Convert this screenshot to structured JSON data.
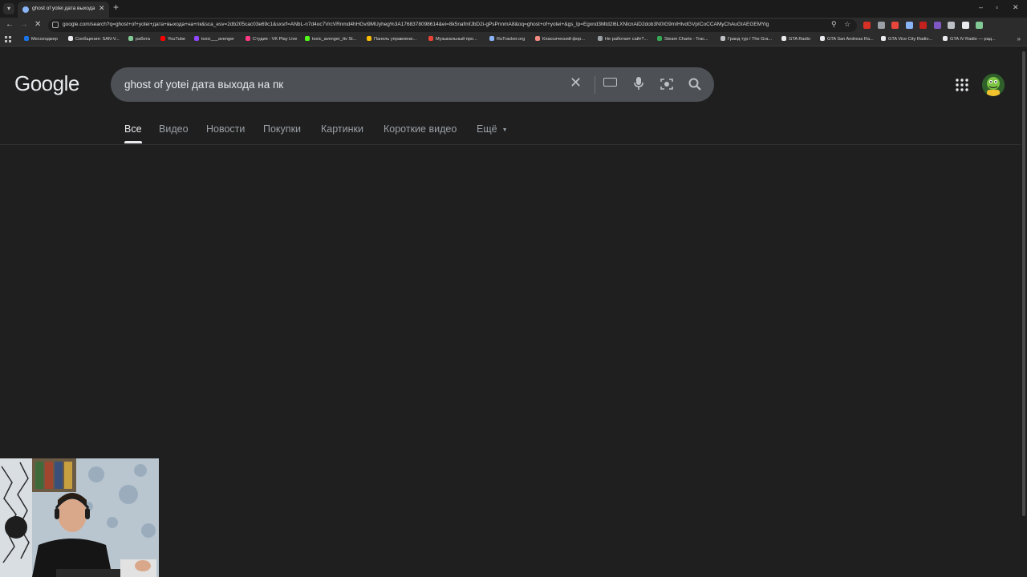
{
  "browser": {
    "tab_title": "ghost of yotei дата выхода на",
    "new_tab_glyph": "+",
    "close_glyph": "✕",
    "url": "google.com/search?q=ghost+of+yotei+дата+выхода+на+пк&sca_esv=2db205cac03e69c1&sxsrf=ANbL-n7d4oc7VrcVRnmd4hHGvi9MUyheg%3A1768378098614&ei=8k5nafmfJbD2i-gPsPnnmA8&oq=ghost+of+yotei+&gs_lp=Egxnd3Mtd2l6LXNlcnAiD2dob3N0IG9mIHlvdGVpICoCCAMyChAuGIAEGEMYig",
    "window_controls": [
      "–",
      "▫",
      "✕"
    ],
    "extension_colors": [
      "#d93025",
      "#9aa0a6",
      "#e8453c",
      "#8ab4f8",
      "#c5221f",
      "#7e57c2",
      "#bdc1c6",
      "#e8eaed",
      "#81c995"
    ]
  },
  "bookmarks": [
    {
      "label": "Мессенджер",
      "color": "#1a73e8"
    },
    {
      "label": "Сообщения: SAN-V...",
      "color": "#e8eaed"
    },
    {
      "label": "работа",
      "color": "#81c995"
    },
    {
      "label": "YouTube",
      "color": "#ff0000"
    },
    {
      "label": "toxic___avenger",
      "color": "#9146ff"
    },
    {
      "label": "Студия - VK Play Live",
      "color": "#ff3985"
    },
    {
      "label": "toxic_avenger_ttv St...",
      "color": "#53fc18"
    },
    {
      "label": "Панель управлени...",
      "color": "#fbbc04"
    },
    {
      "label": "Музыкальный про...",
      "color": "#ea4335"
    },
    {
      "label": "RuTracker.org",
      "color": "#8ab4f8"
    },
    {
      "label": "Классический фор...",
      "color": "#f28b82"
    },
    {
      "label": "Не работает сайт?...",
      "color": "#9aa0a6"
    },
    {
      "label": "Steam Charts - Trac...",
      "color": "#34a853"
    },
    {
      "label": "Гранд тур / The Gra...",
      "color": "#bdc1c6"
    },
    {
      "label": "GTA Radio",
      "color": "#e8eaed"
    },
    {
      "label": "GTA San Andreas Ra...",
      "color": "#e8eaed"
    },
    {
      "label": "GTA Vice City Radio...",
      "color": "#e8eaed"
    },
    {
      "label": "GTA IV Radio — рад...",
      "color": "#e8eaed"
    }
  ],
  "google": {
    "logo": "Google",
    "query": "ghost of yotei дата выхода на пк",
    "tabs": [
      "Все",
      "Видео",
      "Новости",
      "Покупки",
      "Картинки",
      "Короткие видео",
      "Ещё"
    ],
    "active_tab": "Все"
  }
}
